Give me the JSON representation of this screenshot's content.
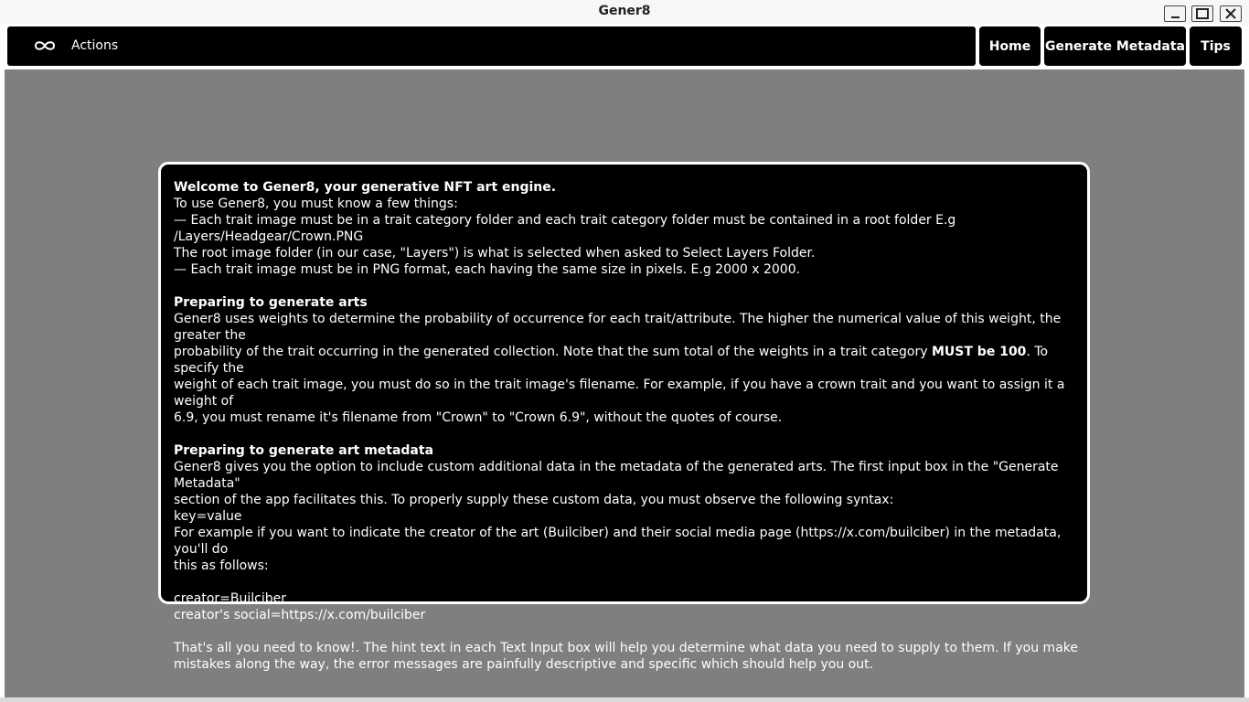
{
  "window": {
    "title": "Gener8",
    "controls": [
      "minimize",
      "maximize",
      "close"
    ]
  },
  "appbar": {
    "menu_icon": "infinity-icon",
    "actions_label": "Actions",
    "nav": {
      "home": "Home",
      "generate_metadata": "Generate Metadata",
      "tips": "Tips"
    }
  },
  "tips": {
    "welcome_heading": "Welcome to Gener8, your generative NFT art engine.",
    "intro": "To use Gener8, you must know a few things:",
    "rule_folder_line1": "— Each trait image must be in a trait category folder and each trait category folder must be contained in a root folder E.g",
    "rule_folder_line2": "/Layers/Headgear/Crown.PNG",
    "root_folder_note": "The root image folder (in our case, \"Layers\") is what is selected when asked to Select Layers Folder.",
    "rule_png": "— Each trait image must be in PNG format, each having the same size in pixels. E.g 2000 x 2000.",
    "arts_heading": "Preparing to generate arts",
    "arts_line1": "Gener8 uses weights to determine the probability of occurrence for each trait/attribute. The higher the numerical value of this weight, the greater the",
    "arts_line2_pre": "probability of the trait occurring in the generated collection. Note that the sum total of the weights in a trait category ",
    "arts_line2_bold": "MUST be 100",
    "arts_line2_post": ". To specify the",
    "arts_line3": "weight of each trait image, you must do so in the trait image's filename. For example, if you have a crown trait and you want to assign it a weight of",
    "arts_line4": "6.9, you must rename it's filename from \"Crown\" to \"Crown 6.9\", without the quotes of course.",
    "meta_heading": "Preparing to generate art metadata",
    "meta_line1": "Gener8 gives you the option to include custom additional data in the metadata of the generated arts. The first input box in the \"Generate Metadata\"",
    "meta_line2": "section of the app facilitates this. To properly supply these custom data, you must observe the following syntax:",
    "syntax": "key=value",
    "example_line1": "For example if you want to indicate the creator of the art (Builciber) and their social media page (https://x.com/builciber) in the metadata, you'll do",
    "example_line2": "this as follows:",
    "example_creator": "creator=Builciber",
    "example_social": "creator's social=https://x.com/builciber",
    "closing_line1": "That's all you need to know!. The hint text in each Text Input box will help you determine what data you need to supply to them. If you make",
    "closing_line2": "mistakes along the way, the error messages are painfully descriptive and specific which should help you out."
  }
}
